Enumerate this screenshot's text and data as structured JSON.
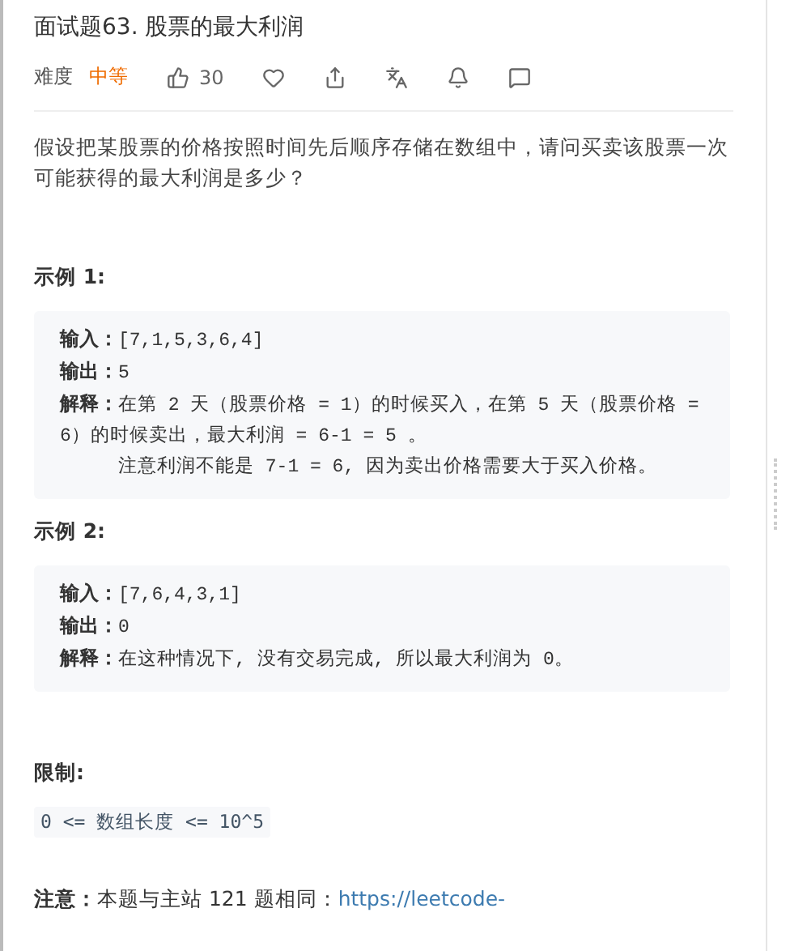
{
  "title": "面试题63. 股票的最大利润",
  "meta": {
    "difficulty_label": "难度",
    "difficulty": "中等",
    "likes": "30"
  },
  "description": "假设把某股票的价格按照时间先后顺序存储在数组中，请问买卖该股票一次可能获得的最大利润是多少？",
  "examples": [
    {
      "title": "示例 1:",
      "lines": [
        {
          "label": "输入：",
          "text": "[7,1,5,3,6,4]"
        },
        {
          "label": "输出：",
          "text": "5"
        },
        {
          "label": "解释：",
          "text": "在第 2 天（股票价格 = 1）的时候买入，在第 5 天（股票价格 = 6）的时候卖出，最大利润 = 6-1 = 5 。"
        }
      ],
      "note": "注意利润不能是 7-1 = 6, 因为卖出价格需要大于买入价格。"
    },
    {
      "title": "示例 2:",
      "lines": [
        {
          "label": "输入：",
          "text": "[7,6,4,3,1]"
        },
        {
          "label": "输出：",
          "text": "0"
        },
        {
          "label": "解释：",
          "text": "在这种情况下, 没有交易完成, 所以最大利润为 0。"
        }
      ]
    }
  ],
  "constraints": {
    "title": "限制:",
    "items": [
      "0 <= 数组长度 <= 10^5"
    ]
  },
  "note": {
    "text": "**注意：**本题与主站 121 题相同：",
    "link": "https://leetcode-"
  }
}
